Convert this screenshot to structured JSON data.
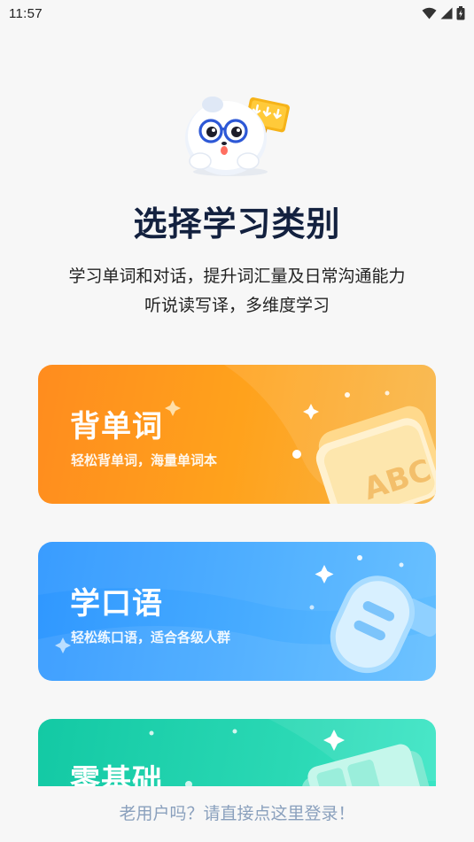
{
  "status_bar": {
    "time": "11:57",
    "icons": [
      "wifi-icon",
      "signal-icon",
      "battery-icon"
    ]
  },
  "header": {
    "title": "选择学习类别",
    "subtitle_line1": "学习单词和对话，提升词汇量及日常沟通能力",
    "subtitle_line2": "听说读写译，多维度学习"
  },
  "categories": [
    {
      "title": "背单词",
      "description": "轻松背单词，海量单词本",
      "badge_text": "ABC",
      "color": "#ff9a1f"
    },
    {
      "title": "学口语",
      "description": "轻松练口语，适合各级人群",
      "color": "#3aa1ff"
    },
    {
      "title": "零基础",
      "description": "",
      "color": "#1fd1ad"
    }
  ],
  "footer": {
    "login_text": "老用户吗？请直接点这里登录！"
  },
  "colors": {
    "title": "#13213f",
    "link": "#8aa0bd",
    "background": "#f7f7f7"
  }
}
